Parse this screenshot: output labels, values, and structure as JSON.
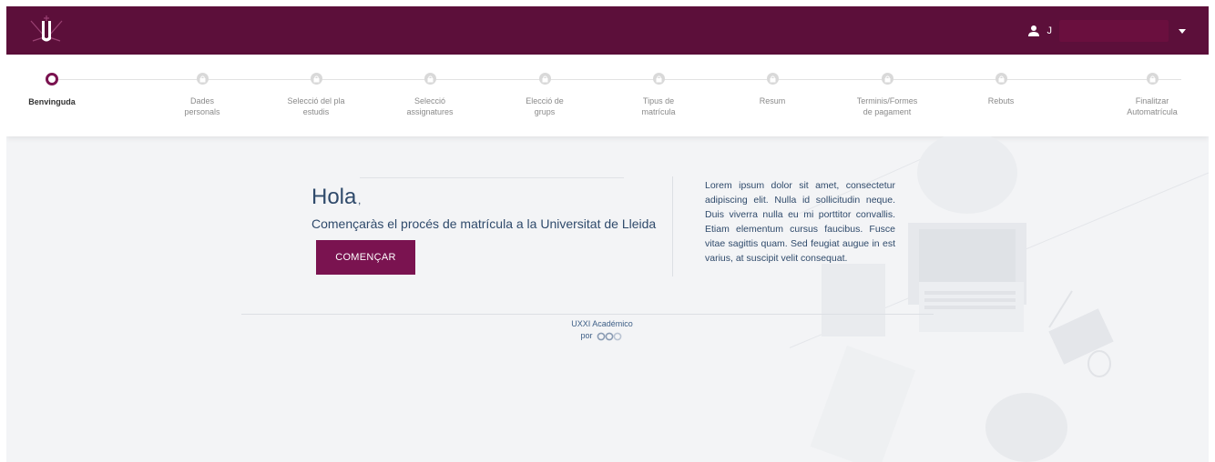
{
  "header": {
    "user_name": "J"
  },
  "stepper": {
    "steps": [
      {
        "label": "Benvinguda",
        "active": true
      },
      {
        "label": "Dades\npersonals",
        "active": false
      },
      {
        "label": "Selecció del pla\nestudis",
        "active": false
      },
      {
        "label": "Selecció\nassignatures",
        "active": false
      },
      {
        "label": "Elecció de\ngrups",
        "active": false
      },
      {
        "label": "Tipus de\nmatrícula",
        "active": false
      },
      {
        "label": "Resum",
        "active": false
      },
      {
        "label": "Terminis/Formes\nde pagament",
        "active": false
      },
      {
        "label": "Rebuts",
        "active": false
      },
      {
        "label": "Finalitzar\nAutomatrícula",
        "active": false
      }
    ]
  },
  "main": {
    "greeting": "Hola",
    "greeting_suffix": ",",
    "subtitle": "Començaràs el procés de matrícula a la Universitat de Lleida",
    "start_button": "COMENÇAR",
    "info_text": "Lorem ipsum dolor sit amet, consectetur adipiscing elit. Nulla id sollicitudin neque. Duis viverra nulla eu mi porttitor convallis. Etiam elementum cursus faucibus. Fusce vitae sagittis quam. Sed feugiat augue in est varius, at suscipit velit consequat."
  },
  "footer": {
    "brand": "UXXI Académico",
    "por": "por"
  },
  "colors": {
    "header_bg": "#5c0f3a",
    "accent": "#7a1350",
    "text_blue": "#2f4a6b"
  }
}
